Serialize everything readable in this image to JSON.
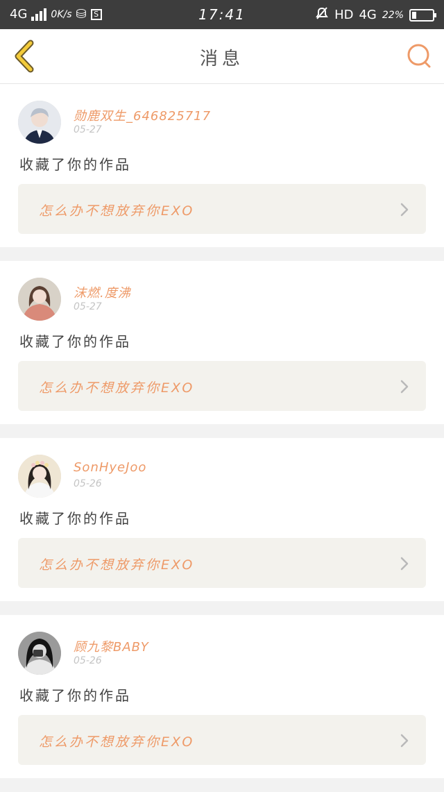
{
  "status_bar": {
    "network": "4G",
    "speed": "0K/s",
    "time": "17:41",
    "hd": "HD",
    "network_right": "4G",
    "battery": "22%"
  },
  "nav": {
    "title": "消息",
    "back_icon": "chevron-left-icon",
    "search_icon": "search-icon",
    "accent": "#ee9a68"
  },
  "messages": [
    {
      "username": "勋鹿双生_646825717",
      "date": "05-27",
      "action": "收藏了你的作品",
      "work_title": "怎么办不想放弃你EXO"
    },
    {
      "username": "沫燃.度沸",
      "date": "05-27",
      "action": "收藏了你的作品",
      "work_title": "怎么办不想放弃你EXO"
    },
    {
      "username": "SonHyeJoo",
      "date": "05-26",
      "action": "收藏了你的作品",
      "work_title": "怎么办不想放弃你EXO"
    },
    {
      "username": "顾九黎BABY",
      "date": "05-26",
      "action": "收藏了你的作品",
      "work_title": "怎么办不想放弃你EXO"
    }
  ]
}
